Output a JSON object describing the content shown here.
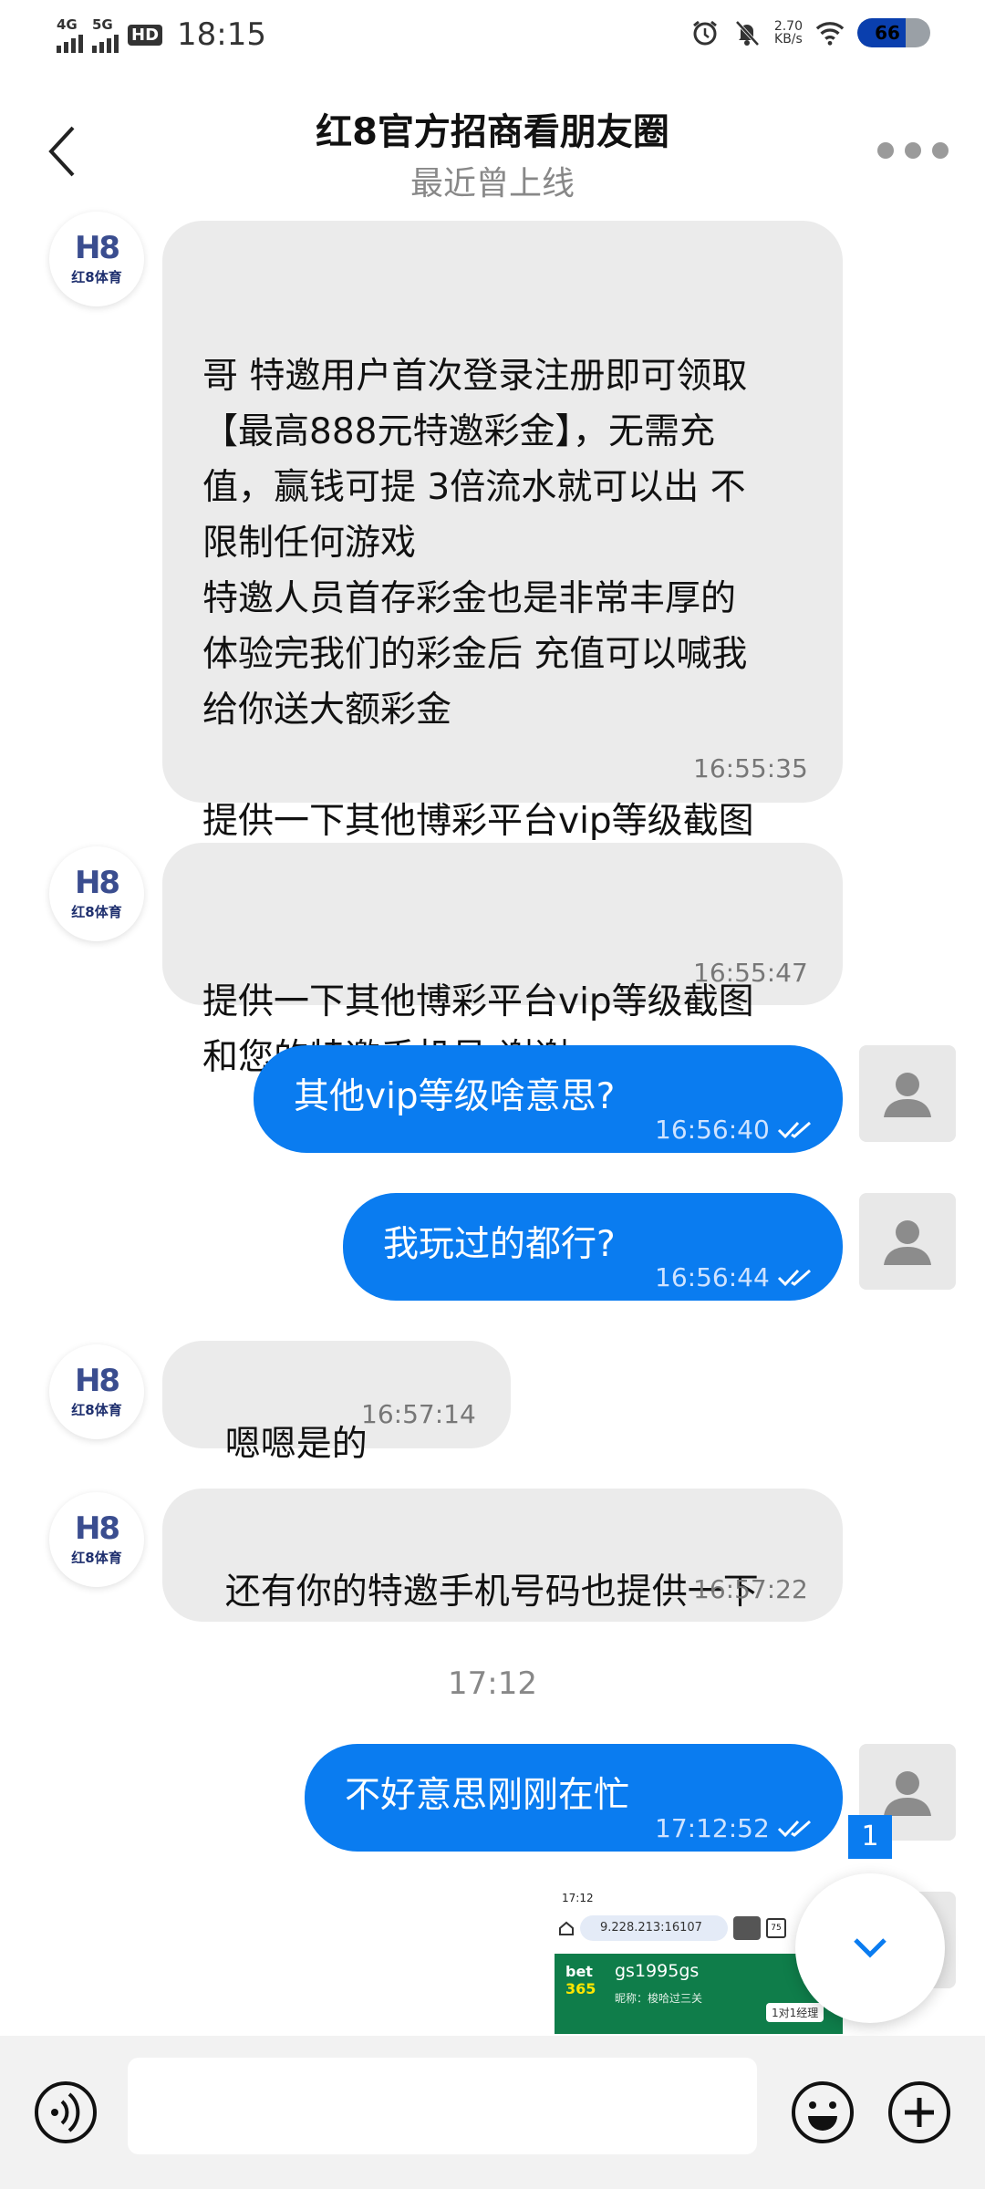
{
  "status_bar": {
    "net1": "4G",
    "net2": "5G",
    "hd": "HD",
    "time": "18:15",
    "speed_value": "2.70",
    "speed_unit": "KB/s",
    "battery": "66",
    "battery_level_pct": 66
  },
  "header": {
    "title": "红8官方招商看朋友圈",
    "subtitle": "最近曾上线"
  },
  "avatar": {
    "logo_mark": "H8",
    "logo_text": "红8体育"
  },
  "messages": [
    {
      "direction": "incoming",
      "text": "哥 特邀用户首次登录注册即可领取\n【最高888元特邀彩金】，无需充\n值，赢钱可提 3倍流水就可以出 不\n限制任何游戏\n特邀人员首存彩金也是非常丰厚的\n体验完我们的彩金后 充值可以喊我\n给你送大额彩金\n\n提供一下其他博彩平台vip等级截图\n和您的特邀手机号 谢谢",
      "time": "16:55:35"
    },
    {
      "direction": "incoming",
      "text": "提供一下其他博彩平台vip等级截图\n和您的特邀手机号 谢谢 .",
      "time": "16:55:47"
    },
    {
      "direction": "outgoing",
      "text": "其他vip等级啥意思?",
      "time": "16:56:40"
    },
    {
      "direction": "outgoing",
      "text": "我玩过的都行?",
      "time": "16:56:44"
    },
    {
      "direction": "incoming",
      "text": "嗯嗯是的",
      "time": "16:57:14"
    },
    {
      "direction": "incoming",
      "text": "还有你的特邀手机号码也提供一下",
      "time": "16:57:22"
    },
    {
      "direction": "outgoing",
      "text": "不好意思刚刚在忙",
      "time": "17:12:52"
    }
  ],
  "date_separator": "17:12",
  "unread_count": "1",
  "image_preview": {
    "status_time": "17:12",
    "url": "9.228.213:16107",
    "tab_count": "75",
    "logo_top": "bet",
    "logo_bottom": "365",
    "username": "gs1995gs",
    "nickname": "昵称：梭哈过三关",
    "tag": "1对1经理",
    "colors": {
      "green": "#0f7d4a",
      "logo_yellow": "#ffe600"
    }
  },
  "colors": {
    "outgoing_bubble": "#0a7cf0",
    "incoming_bubble": "#ebebeb",
    "battery_fill": "#0a3fae"
  },
  "icons": {
    "back": "chevron-left-icon",
    "more": "more-dots-icon",
    "voice": "voice-icon",
    "emoji": "emoji-icon",
    "plus": "plus-icon",
    "scroll_down": "chevron-down-icon",
    "check": "double-check-icon"
  }
}
